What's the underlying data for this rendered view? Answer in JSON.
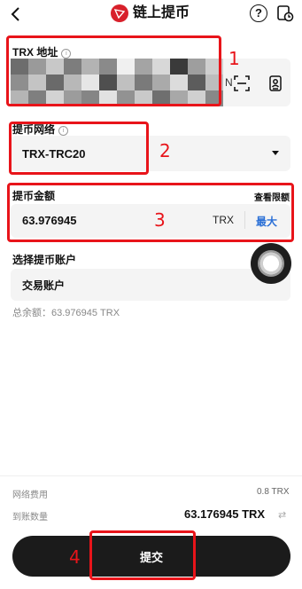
{
  "header": {
    "back_icon": "chevron-left-icon",
    "title": "链上提币",
    "logo_color": "#d8202b"
  },
  "address": {
    "label": "TRX 地址",
    "info": "i",
    "partial_char": "N"
  },
  "network": {
    "label": "提币网络",
    "info": "i",
    "value": "TRX-TRC20"
  },
  "amount": {
    "label": "提币金额",
    "limit_link": "查看限额",
    "value": "63.976945",
    "unit": "TRX",
    "max_label": "最大"
  },
  "account": {
    "label": "选择提币账户",
    "value": "交易账户",
    "total": "总余额：63.976945 TRX"
  },
  "summary": {
    "fee_label": "网络费用",
    "fee_value": "0.8 TRX",
    "receive_label": "到账数量",
    "receive_value": "63.176945 TRX"
  },
  "submit": {
    "label": "提交"
  },
  "annotations": [
    "1",
    "2",
    "3",
    "4"
  ],
  "colors": {
    "annotation": "#e8141a",
    "accent": "#2a6fd6",
    "button": "#1b1b1b"
  }
}
